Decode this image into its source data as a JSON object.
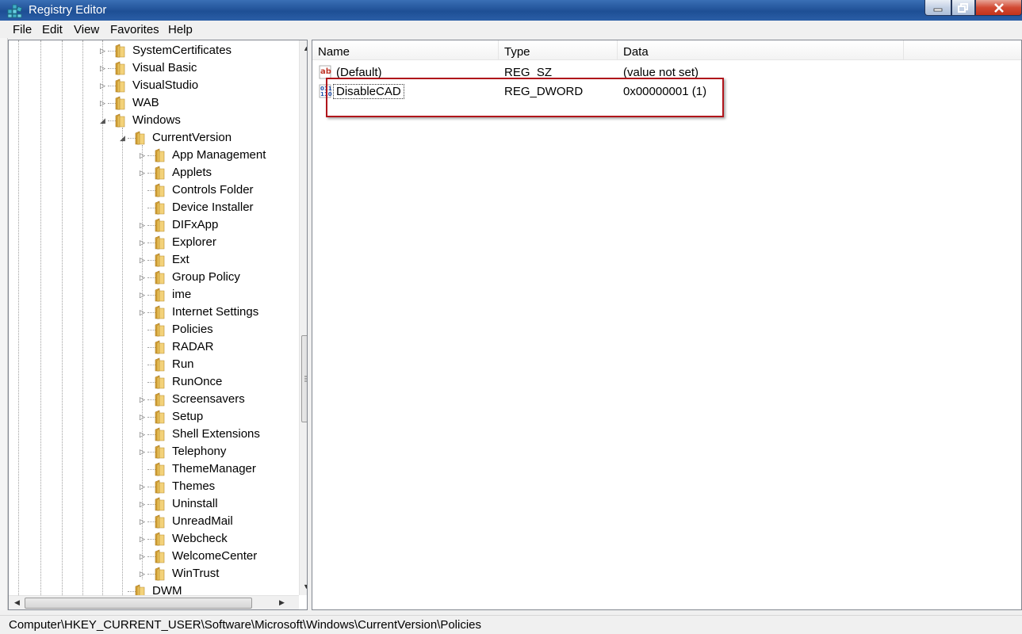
{
  "window": {
    "title": "Registry Editor"
  },
  "menu": [
    "File",
    "Edit",
    "View",
    "Favorites",
    "Help"
  ],
  "tree": {
    "items": [
      {
        "label": "SystemCertificates",
        "level": 0,
        "expander": "collapsed"
      },
      {
        "label": "Visual Basic",
        "level": 0,
        "expander": "collapsed"
      },
      {
        "label": "VisualStudio",
        "level": 0,
        "expander": "collapsed"
      },
      {
        "label": "WAB",
        "level": 0,
        "expander": "collapsed"
      },
      {
        "label": "Windows",
        "level": 0,
        "expander": "expanded"
      },
      {
        "label": "CurrentVersion",
        "level": 1,
        "expander": "expanded"
      },
      {
        "label": "App Management",
        "level": 2,
        "expander": "collapsed"
      },
      {
        "label": "Applets",
        "level": 2,
        "expander": "collapsed"
      },
      {
        "label": "Controls Folder",
        "level": 2,
        "expander": "none"
      },
      {
        "label": "Device Installer",
        "level": 2,
        "expander": "none"
      },
      {
        "label": "DIFxApp",
        "level": 2,
        "expander": "collapsed"
      },
      {
        "label": "Explorer",
        "level": 2,
        "expander": "collapsed"
      },
      {
        "label": "Ext",
        "level": 2,
        "expander": "collapsed"
      },
      {
        "label": "Group Policy",
        "level": 2,
        "expander": "collapsed"
      },
      {
        "label": "ime",
        "level": 2,
        "expander": "collapsed"
      },
      {
        "label": "Internet Settings",
        "level": 2,
        "expander": "collapsed"
      },
      {
        "label": "Policies",
        "level": 2,
        "expander": "none"
      },
      {
        "label": "RADAR",
        "level": 2,
        "expander": "none"
      },
      {
        "label": "Run",
        "level": 2,
        "expander": "none"
      },
      {
        "label": "RunOnce",
        "level": 2,
        "expander": "none"
      },
      {
        "label": "Screensavers",
        "level": 2,
        "expander": "collapsed"
      },
      {
        "label": "Setup",
        "level": 2,
        "expander": "collapsed"
      },
      {
        "label": "Shell Extensions",
        "level": 2,
        "expander": "collapsed"
      },
      {
        "label": "Telephony",
        "level": 2,
        "expander": "collapsed"
      },
      {
        "label": "ThemeManager",
        "level": 2,
        "expander": "none"
      },
      {
        "label": "Themes",
        "level": 2,
        "expander": "collapsed"
      },
      {
        "label": "Uninstall",
        "level": 2,
        "expander": "collapsed"
      },
      {
        "label": "UnreadMail",
        "level": 2,
        "expander": "collapsed"
      },
      {
        "label": "Webcheck",
        "level": 2,
        "expander": "collapsed"
      },
      {
        "label": "WelcomeCenter",
        "level": 2,
        "expander": "collapsed"
      },
      {
        "label": "WinTrust",
        "level": 2,
        "expander": "collapsed"
      },
      {
        "label": "DWM",
        "level": 1,
        "expander": "none"
      }
    ]
  },
  "list": {
    "columns": [
      "Name",
      "Type",
      "Data"
    ],
    "rows": [
      {
        "icon": "string-value-icon",
        "name": "(Default)",
        "type": "REG_SZ",
        "data": "(value not set)"
      },
      {
        "icon": "dword-value-icon",
        "name": "DisableCAD",
        "type": "REG_DWORD",
        "data": "0x00000001 (1)"
      }
    ]
  },
  "status": {
    "path": "Computer\\HKEY_CURRENT_USER\\Software\\Microsoft\\Windows\\CurrentVersion\\Policies"
  },
  "colors": {
    "titlebar": "#1e4f95",
    "highlight_box": "#b0151b",
    "folder": "#e8c15a"
  }
}
